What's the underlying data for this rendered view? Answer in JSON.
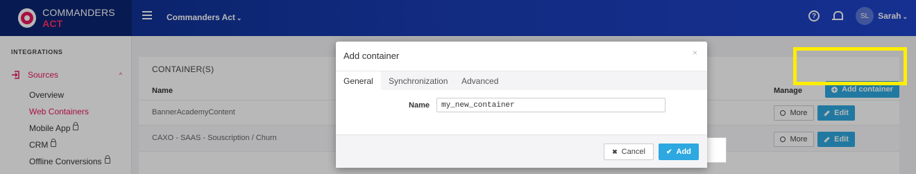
{
  "topbar": {
    "brand_main": "COMMANDERS",
    "brand_accent": "ACT",
    "org_name": "Commanders Act",
    "org_chevron": "⌄",
    "help_glyph": "?",
    "user_initials": "SL",
    "user_name": "Sarah",
    "user_chevron": "⌄"
  },
  "sidebar": {
    "section_title": "INTEGRATIONS",
    "sources_label": "Sources",
    "sources_caret": "^",
    "items": [
      {
        "label": "Overview"
      },
      {
        "label": "Web Containers"
      },
      {
        "label": "Mobile App"
      },
      {
        "label": "CRM"
      },
      {
        "label": "Offline Conversions"
      }
    ]
  },
  "main": {
    "card_title": "CONTAINER(S)",
    "add_button_label": "Add container",
    "columns": {
      "name": "Name",
      "manage": "Manage"
    },
    "rows": [
      {
        "name": "BannerAcademyContent",
        "more_label": "More",
        "edit_label": "Edit"
      },
      {
        "name": "CAXO - SAAS - Souscription / Churn",
        "more_label": "More",
        "edit_label": "Edit"
      }
    ]
  },
  "modal": {
    "title": "Add container",
    "close_glyph": "×",
    "tabs": [
      {
        "label": "General",
        "active": true
      },
      {
        "label": "Synchronization",
        "active": false
      },
      {
        "label": "Advanced",
        "active": false
      }
    ],
    "name_label": "Name",
    "name_value": "my_new_container",
    "cancel_label": "Cancel",
    "add_label": "Add",
    "cancel_glyph": "✖",
    "add_glyph": "✔"
  },
  "colors": {
    "accent_pink": "#e8175d",
    "primary_blue": "#2ea8e0",
    "topbar_blue": "#1a3db5",
    "highlight_yellow": "#ffee00"
  }
}
